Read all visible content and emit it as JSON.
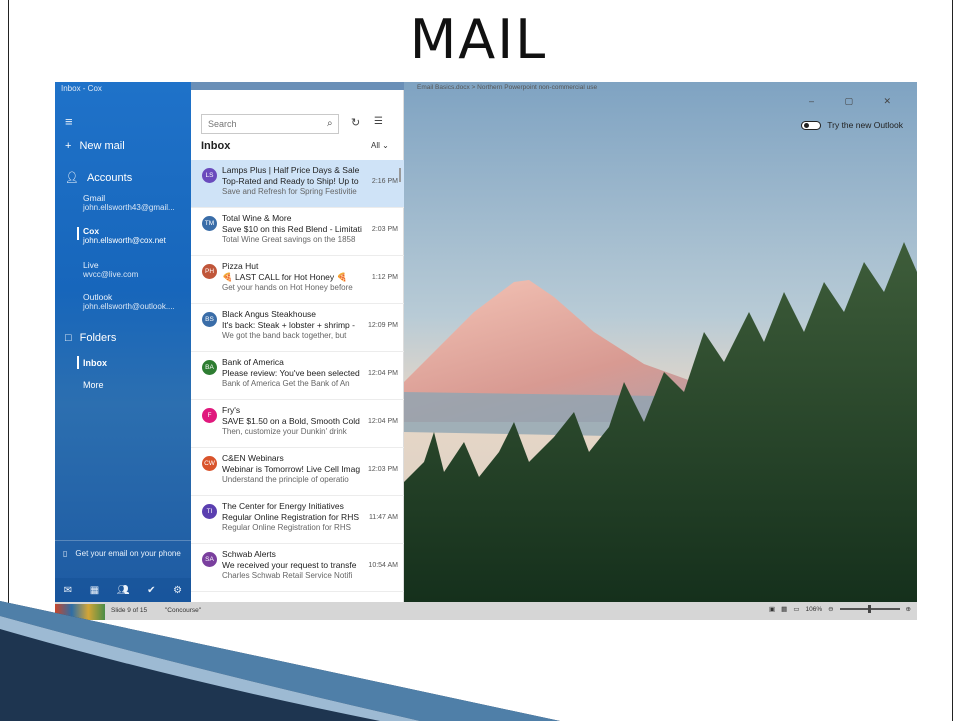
{
  "slide": {
    "title": "MAIL"
  },
  "window": {
    "title": "Inbox - Cox",
    "breadcrumb": "Email Basics.docx  >  Northern Powerpoint non-commercial use",
    "controls": "–  ▢  ✕",
    "try_new_outlook": "Try the new Outlook"
  },
  "nav": {
    "new_mail": "New mail",
    "accounts_label": "Accounts",
    "accounts": [
      {
        "name": "Gmail",
        "email": "john.ellsworth43@gmail...",
        "selected": false
      },
      {
        "name": "Cox",
        "email": "john.ellsworth@cox.net",
        "selected": true
      },
      {
        "name": "Live",
        "email": "wvcc@live.com",
        "selected": false
      },
      {
        "name": "Outlook",
        "email": "john.ellsworth@outlook....",
        "selected": false
      }
    ],
    "folders_label": "Folders",
    "folders": [
      {
        "name": "Inbox",
        "selected": true
      },
      {
        "name": "More",
        "selected": false
      }
    ],
    "promo": "Get your email on your phone"
  },
  "list": {
    "search_placeholder": "Search",
    "heading": "Inbox",
    "filter": "All",
    "messages": [
      {
        "initials": "LS",
        "color": "#6a4bbd",
        "from": "Lamps Plus | Half Price Days & Sale",
        "subject": "Top-Rated and Ready to Ship! Up to",
        "time": "2:16 PM",
        "preview": "Save and Refresh for Spring Festivitie",
        "selected": true
      },
      {
        "initials": "TM",
        "color": "#3a6da8",
        "from": "Total Wine & More",
        "subject": "Save $10 on this Red Blend - Limitati",
        "time": "2:03 PM",
        "preview": "Total Wine Great savings on the 1858",
        "selected": false
      },
      {
        "initials": "PH",
        "color": "#c0563a",
        "from": "Pizza Hut",
        "subject": "🍕 LAST CALL for Hot Honey 🍕",
        "time": "1:12 PM",
        "preview": "Get your hands on Hot Honey before",
        "selected": false
      },
      {
        "initials": "BS",
        "color": "#3a6da8",
        "from": "Black Angus Steakhouse",
        "subject": "It's back: Steak + lobster + shrimp -",
        "time": "12:09 PM",
        "preview": "We got the band back together, but",
        "selected": false
      },
      {
        "initials": "BA",
        "color": "#2e7d32",
        "from": "Bank of America",
        "subject": "Please review: You've been selected",
        "time": "12:04 PM",
        "preview": "Bank of America Get the Bank of An",
        "selected": false
      },
      {
        "initials": "F",
        "color": "#e0197d",
        "from": "Fry's",
        "subject": "SAVE $1.50 on a Bold, Smooth Cold",
        "time": "12:04 PM",
        "preview": "Then, customize your Dunkin' drink",
        "selected": false
      },
      {
        "initials": "CW",
        "color": "#d9542c",
        "from": "C&EN Webinars",
        "subject": "Webinar is Tomorrow! Live Cell Imag",
        "time": "12:03 PM",
        "preview": "Understand the principle of operatio",
        "selected": false
      },
      {
        "initials": "TI",
        "color": "#5b3fb0",
        "from": "The Center for Energy Initiatives",
        "subject": "Regular Online Registration for RHS",
        "time": "11:47 AM",
        "preview": "Regular Online Registration for RHS",
        "selected": false
      },
      {
        "initials": "SA",
        "color": "#7a3f9e",
        "from": "Schwab Alerts",
        "subject": "We received your request to transfe",
        "time": "10:54 AM",
        "preview": "Charles Schwab Retail Service Notifi",
        "selected": false
      }
    ]
  },
  "statusbar": {
    "slide_info": "Slide 9 of 15",
    "theme": "\"Concourse\"",
    "zoom": "106%"
  }
}
